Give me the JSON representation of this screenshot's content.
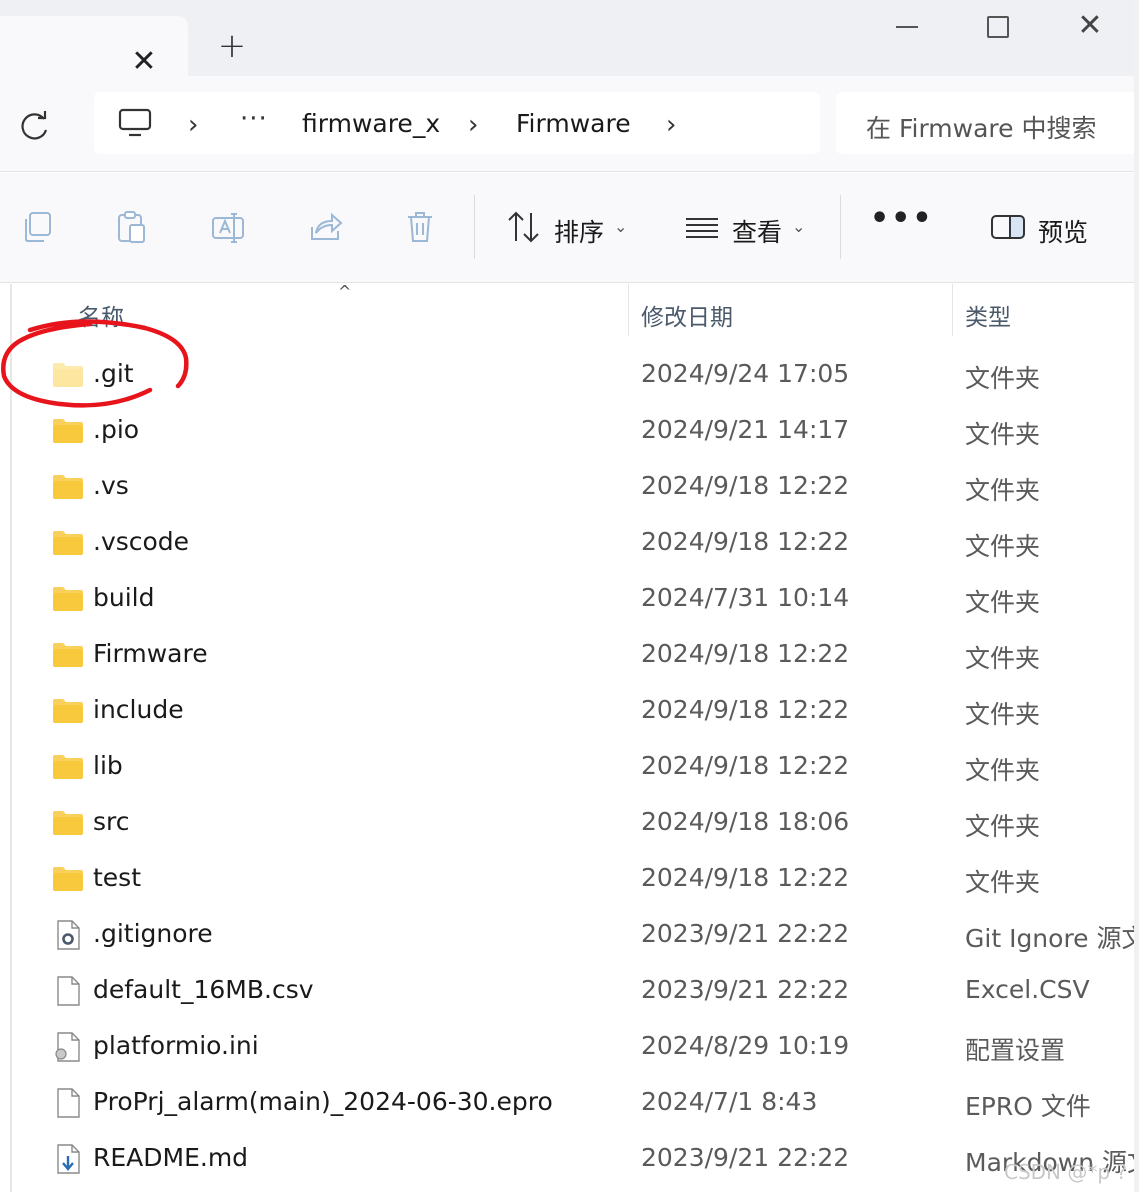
{
  "window": {
    "tab_close_glyph": "✕",
    "new_tab_glyph": "+",
    "close_glyph": "✕"
  },
  "address": {
    "overflow": "···",
    "breadcrumbs": [
      "firmware_x",
      "Firmware"
    ],
    "separator": "›",
    "search_placeholder": "在 Firmware 中搜索"
  },
  "toolbar": {
    "sort_label": "排序",
    "view_label": "查看",
    "more_label": "•••",
    "preview_label": "预览",
    "chevron": "⌄",
    "icons": [
      "copy-icon",
      "paste-icon",
      "rename-icon",
      "share-icon",
      "delete-icon",
      "sort-icon",
      "view-icon",
      "preview-pane-icon"
    ]
  },
  "columns": {
    "name": "名称",
    "modified": "修改日期",
    "type": "类型",
    "sort_caret": "^"
  },
  "files": [
    {
      "name": ".git",
      "date": "2024/9/24 17:05",
      "type": "文件夹",
      "icon": "folder-hidden"
    },
    {
      "name": ".pio",
      "date": "2024/9/21 14:17",
      "type": "文件夹",
      "icon": "folder"
    },
    {
      "name": ".vs",
      "date": "2024/9/18 12:22",
      "type": "文件夹",
      "icon": "folder"
    },
    {
      "name": ".vscode",
      "date": "2024/9/18 12:22",
      "type": "文件夹",
      "icon": "folder"
    },
    {
      "name": "build",
      "date": "2024/7/31 10:14",
      "type": "文件夹",
      "icon": "folder"
    },
    {
      "name": "Firmware",
      "date": "2024/9/18 12:22",
      "type": "文件夹",
      "icon": "folder"
    },
    {
      "name": "include",
      "date": "2024/9/18 12:22",
      "type": "文件夹",
      "icon": "folder"
    },
    {
      "name": "lib",
      "date": "2024/9/18 12:22",
      "type": "文件夹",
      "icon": "folder"
    },
    {
      "name": "src",
      "date": "2024/9/18 18:06",
      "type": "文件夹",
      "icon": "folder"
    },
    {
      "name": "test",
      "date": "2024/9/18 12:22",
      "type": "文件夹",
      "icon": "folder"
    },
    {
      "name": ".gitignore",
      "date": "2023/9/21 22:22",
      "type": "Git Ignore 源文件",
      "icon": "gear-file"
    },
    {
      "name": "default_16MB.csv",
      "date": "2023/9/21 22:22",
      "type": "Excel.CSV",
      "icon": "blank-file"
    },
    {
      "name": "platformio.ini",
      "date": "2024/8/29 10:19",
      "type": "配置设置",
      "icon": "settings-file"
    },
    {
      "name": "ProPrj_alarm(main)_2024-06-30.epro",
      "date": "2024/7/1 8:43",
      "type": "EPRO 文件",
      "icon": "blank-file"
    },
    {
      "name": "README.md",
      "date": "2023/9/21 22:22",
      "type": "Markdown 源文件",
      "icon": "markdown-file"
    }
  ],
  "watermark": "CSDN @*p ?",
  "colors": {
    "folder": "#f8c93d",
    "folder_light": "#fde6a0",
    "annotation": "#e8141b",
    "accent": "#1b6ec2"
  }
}
